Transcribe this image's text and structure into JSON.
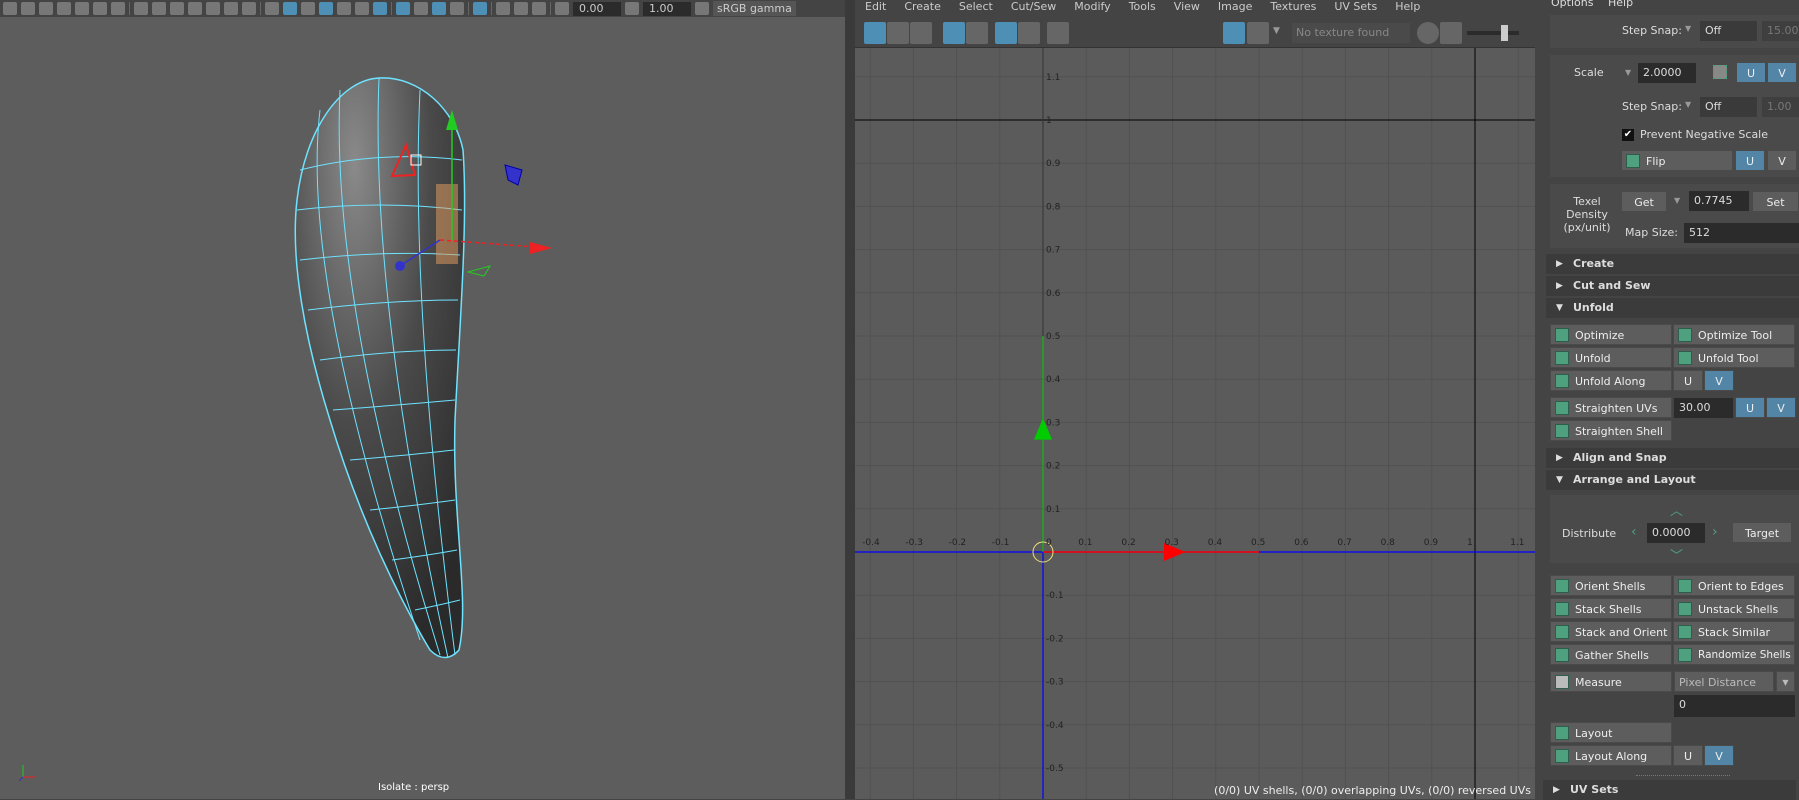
{
  "viewport": {
    "exposure": "0.00",
    "gamma": "1.00",
    "color_space": "sRGB gamma",
    "label": "Isolate : persp"
  },
  "uv_editor": {
    "menu": [
      "Edit",
      "Create",
      "Select",
      "Cut/Sew",
      "Modify",
      "Tools",
      "View",
      "Image",
      "Textures",
      "UV Sets",
      "Help"
    ],
    "texture_field": "No texture found",
    "u_ticks": [
      "-0.4",
      "-0.3",
      "-0.2",
      "-0.1",
      "0",
      "0.1",
      "0.2",
      "0.3",
      "0.4",
      "0.5",
      "0.6",
      "0.7",
      "0.8",
      "0.9",
      "1",
      "1.1"
    ],
    "v_ticks": [
      "1.1",
      "1",
      "0.9",
      "0.8",
      "0.7",
      "0.6",
      "0.5",
      "0.4",
      "0.3",
      "0.2",
      "0.1",
      "-0.1",
      "-0.2",
      "-0.3",
      "-0.4",
      "-0.5"
    ],
    "status": "(0/0) UV shells, (0/0) overlapping UVs, (0/0) reversed UVs",
    "axis_colors": {
      "u": "#ff0000",
      "v": "#00cc00",
      "grid_axis": "#0000ff"
    }
  },
  "panel": {
    "menu": [
      "Options",
      "Help"
    ],
    "step_snap_label": "Step Snap:",
    "rotate_snap": "Off",
    "rotate_snap_value": "15.00",
    "scale_label": "Scale",
    "scale_value": "2.0000",
    "u": "U",
    "v": "V",
    "scale_snap": "Off",
    "scale_snap_value": "1.00",
    "prevent_negative": "Prevent Negative Scale",
    "prevent_negative_checked": true,
    "flip": "Flip",
    "texel_label": "Texel Density (px/unit)",
    "get": "Get",
    "texel_value": "0.7745",
    "set": "Set",
    "map_size_label": "Map Size:",
    "map_size": "512",
    "sections": {
      "create": "Create",
      "cut_sew": "Cut and Sew",
      "unfold": "Unfold",
      "align": "Align and Snap",
      "arrange": "Arrange and Layout",
      "uv_sets": "UV Sets"
    },
    "unfold": {
      "optimize": "Optimize",
      "optimize_tool": "Optimize Tool",
      "unfold": "Unfold",
      "unfold_tool": "Unfold Tool",
      "unfold_along": "Unfold Along",
      "straighten_uvs": "Straighten UVs",
      "straighten_value": "30.00",
      "straighten_shell": "Straighten Shell"
    },
    "arrange": {
      "distribute": "Distribute",
      "distribute_value": "0.0000",
      "target": "Target",
      "orient_shells": "Orient Shells",
      "orient_edges": "Orient to Edges",
      "stack_shells": "Stack Shells",
      "unstack_shells": "Unstack Shells",
      "stack_orient": "Stack and Orient",
      "stack_similar": "Stack Similar",
      "gather_shells": "Gather Shells",
      "randomize_shells": "Randomize Shells",
      "measure": "Measure",
      "measure_mode": "Pixel Distance",
      "measure_value": "0",
      "layout": "Layout",
      "layout_along": "Layout Along"
    },
    "accent": "#5285a6"
  }
}
